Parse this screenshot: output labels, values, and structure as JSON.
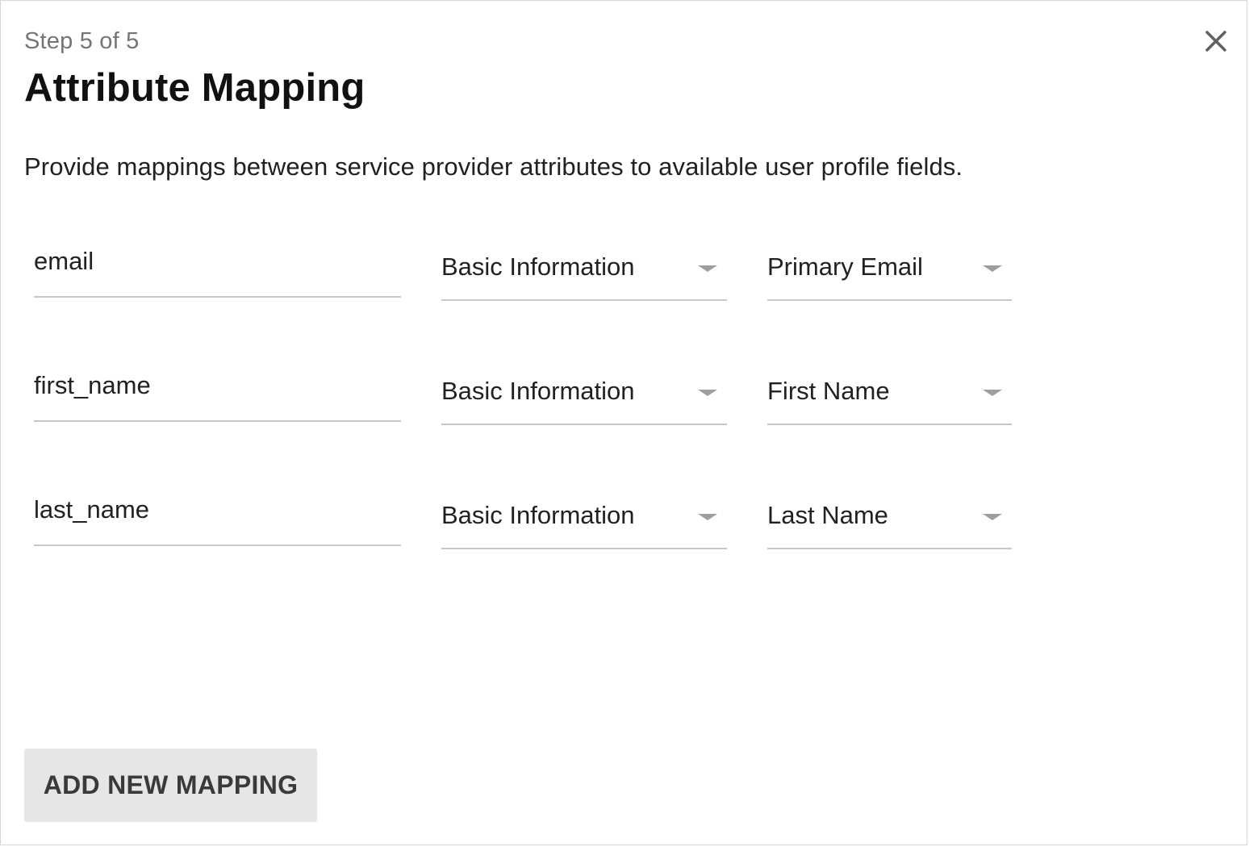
{
  "header": {
    "step": "Step 5 of 5",
    "title": "Attribute Mapping",
    "close_icon": "close-icon"
  },
  "description": "Provide mappings between service provider attributes to available user profile fields.",
  "mappings": [
    {
      "attribute": "email",
      "category": "Basic Information",
      "field": "Primary Email"
    },
    {
      "attribute": "first_name",
      "category": "Basic Information",
      "field": "First Name"
    },
    {
      "attribute": "last_name",
      "category": "Basic Information",
      "field": "Last Name"
    }
  ],
  "footer": {
    "add_label": "ADD NEW MAPPING"
  },
  "colors": {
    "underline": "#c8c8c8",
    "caret": "#9e9e9e",
    "button_bg": "#e6e6e6"
  }
}
